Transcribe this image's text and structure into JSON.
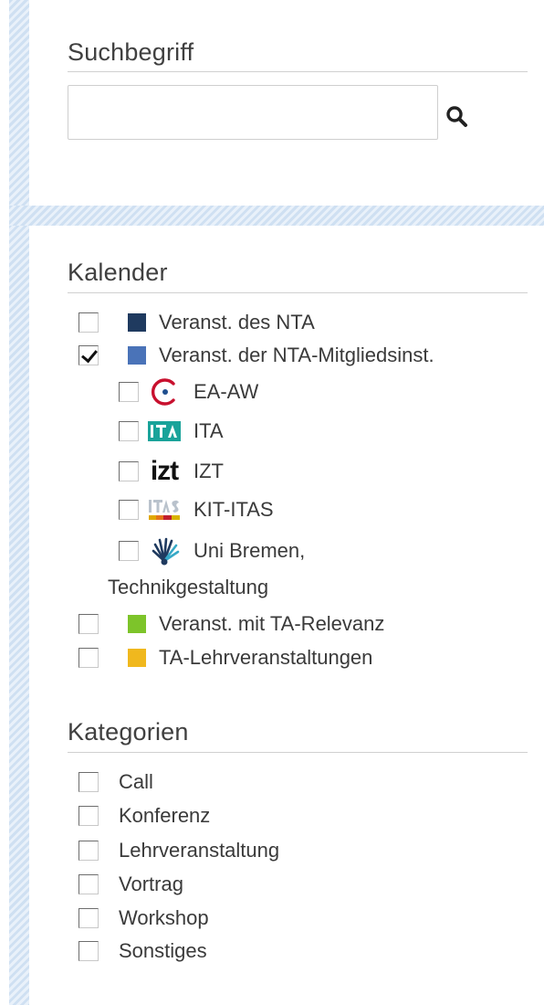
{
  "search": {
    "label": "Suchbegriff",
    "value": "",
    "placeholder": ""
  },
  "kalender": {
    "title": "Kalender",
    "items": [
      {
        "label": "Veranst. des NTA",
        "checked": false,
        "color": "#1f3a5f"
      },
      {
        "label": "Veranst. der NTA-Mitgliedsinst.",
        "checked": true,
        "color": "#4a73b8"
      }
    ],
    "subitems": [
      {
        "label": "EA-AW",
        "checked": false,
        "icon": "ea-aw-logo-icon"
      },
      {
        "label": "ITA",
        "checked": false,
        "icon": "ita-logo-icon"
      },
      {
        "label": "IZT",
        "checked": false,
        "icon": "izt-logo-icon",
        "logo_text": "izt"
      },
      {
        "label": "KIT-ITAS",
        "checked": false,
        "icon": "itas-logo-icon"
      },
      {
        "label": "Uni Bremen,",
        "label_cont": "Technikgestaltung",
        "checked": false,
        "icon": "uni-bremen-logo-icon"
      }
    ],
    "items2": [
      {
        "label": "Veranst. mit TA-Relevanz",
        "checked": false,
        "color": "#7dc42a"
      },
      {
        "label": "TA-Lehrveranstaltungen",
        "checked": false,
        "color": "#f0b81e"
      }
    ]
  },
  "kategorien": {
    "title": "Kategorien",
    "items": [
      {
        "label": "Call",
        "checked": false
      },
      {
        "label": "Konferenz",
        "checked": false
      },
      {
        "label": "Lehrveranstaltung",
        "checked": false
      },
      {
        "label": "Vortrag",
        "checked": false
      },
      {
        "label": "Workshop",
        "checked": false
      },
      {
        "label": "Sonstiges",
        "checked": false
      }
    ]
  }
}
